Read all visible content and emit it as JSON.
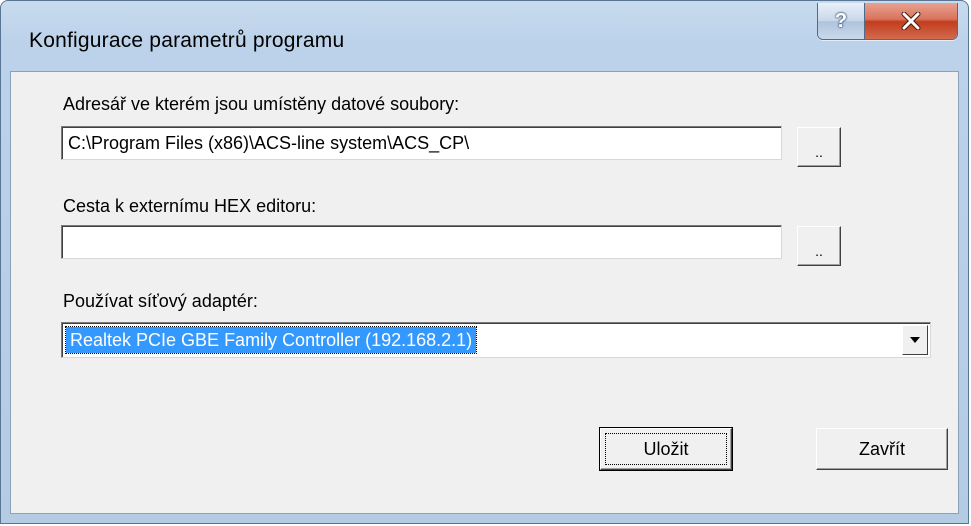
{
  "window": {
    "title": "Konfigurace parametrů programu",
    "help_glyph": "?"
  },
  "data_dir": {
    "label": "Adresář ve kterém jsou umístěny datové soubory:",
    "value": "C:\\Program Files (x86)\\ACS-line system\\ACS_CP\\",
    "browse_label": ".."
  },
  "hex_editor": {
    "label": "Cesta k externímu HEX editoru:",
    "value": "",
    "browse_label": ".."
  },
  "adapter": {
    "label": "Používat síťový adaptér:",
    "selected": "Realtek PCIe GBE Family Controller (192.168.2.1)"
  },
  "buttons": {
    "save": "Uložit",
    "close": "Zavřít"
  },
  "colors": {
    "selection": "#3399ff",
    "close_button": "#c23d1e",
    "face": "#f0f0f0"
  }
}
